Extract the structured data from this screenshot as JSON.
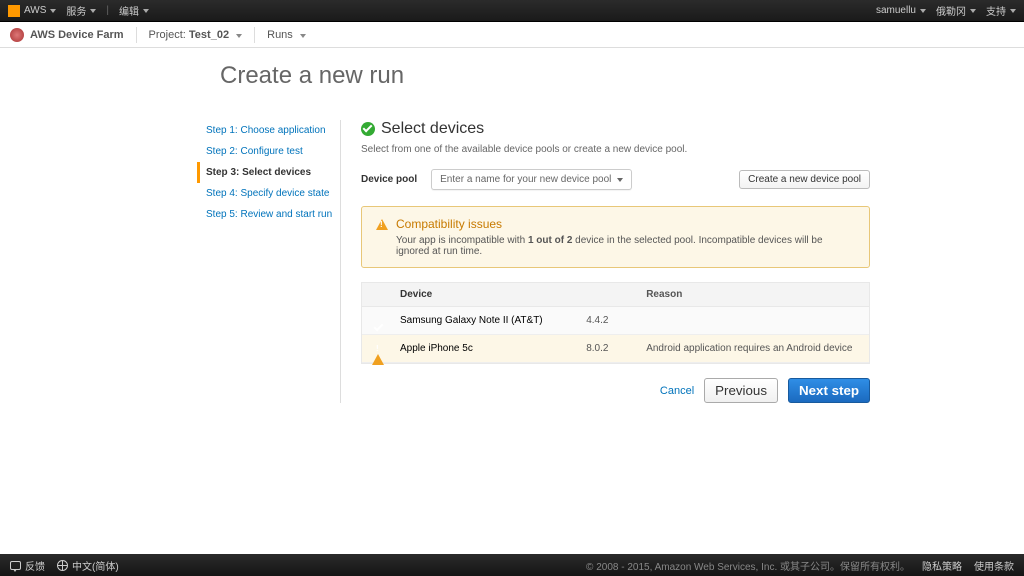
{
  "topbar": {
    "brand": "AWS",
    "menu_services": "服务",
    "menu_edit": "编辑",
    "user": "samuellu",
    "region": "俄勒冈",
    "support": "支持"
  },
  "navbar": {
    "product": "AWS Device Farm",
    "project_prefix": "Project: ",
    "project_name": "Test_02",
    "runs": "Runs"
  },
  "page_title": "Create a new run",
  "steps": [
    "Step 1: Choose application",
    "Step 2: Configure test",
    "Step 3: Select devices",
    "Step 4: Specify device state",
    "Step 5: Review and start run"
  ],
  "active_step_index": 2,
  "section": {
    "title": "Select devices",
    "subtitle": "Select from one of the available device pools or create a new device pool."
  },
  "device_pool": {
    "label": "Device pool",
    "placeholder": "Enter a name for your new device pool",
    "create_button": "Create a new device pool"
  },
  "alert": {
    "title": "Compatibility issues",
    "body_prefix": "Your app is incompatible with ",
    "body_bold": "1 out of 2",
    "body_suffix": " device in the selected pool. Incompatible devices will be ignored at run time."
  },
  "table": {
    "headers": {
      "device": "Device",
      "reason": "Reason"
    },
    "rows": [
      {
        "status": "ok",
        "device": "Samsung Galaxy Note II (AT&T)",
        "version": "4.4.2",
        "reason": ""
      },
      {
        "status": "warn",
        "device": "Apple iPhone 5c",
        "version": "8.0.2",
        "reason": "Android application requires an Android device"
      }
    ]
  },
  "actions": {
    "cancel": "Cancel",
    "previous": "Previous",
    "next": "Next step"
  },
  "footer": {
    "feedback": "反馈",
    "language": "中文(简体)",
    "copyright": "© 2008 - 2015, Amazon Web Services, Inc. 或其子公司。保留所有权利。",
    "privacy": "隐私策略",
    "terms": "使用条款"
  }
}
